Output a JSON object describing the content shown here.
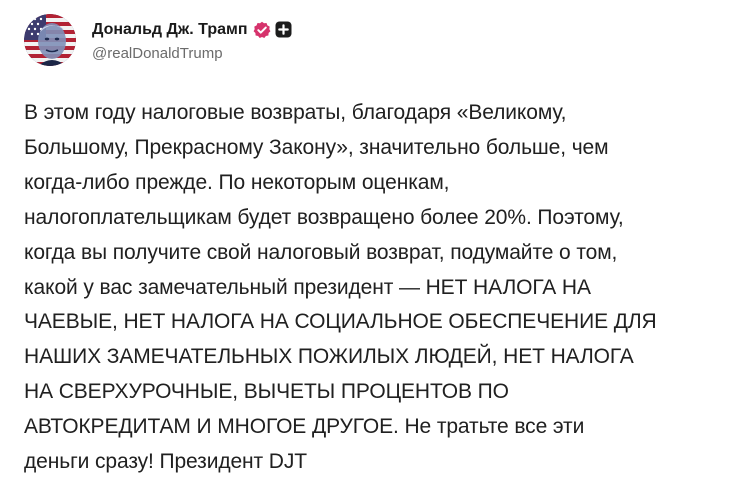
{
  "author": {
    "display_name": "Дональд Дж. Трамп",
    "handle": "@realDonaldTrump",
    "verified_color": "#d6336c",
    "icons": [
      "avatar",
      "verified-badge-icon",
      "add-icon"
    ]
  },
  "post": {
    "lines": [
      "В этом году налоговые возвраты, благодаря «Великому,",
      "Большому, Прекрасному Закону», значительно больше, чем",
      "когда-либо прежде. По некоторым оценкам,",
      "налогоплательщикам будет возвращено более 20%. Поэтому,",
      "когда вы получите свой налоговый возврат, подумайте о том,",
      "какой у вас замечательный президент — НЕТ НАЛОГА НА",
      "ЧАЕВЫЕ, НЕТ НАЛОГА НА СОЦИАЛЬНОЕ ОБЕСПЕЧЕНИЕ ДЛЯ",
      "НАШИХ ЗАМЕЧАТЕЛЬНЫХ ПОЖИЛЫХ ЛЮДЕЙ, НЕТ НАЛОГА",
      "НА СВЕРХУРОЧНЫЕ, ВЫЧЕТЫ ПРОЦЕНТОВ ПО",
      "АВТОКРЕДИТАМ И МНОГОЕ ДРУГОЕ. Не тратьте все эти",
      "деньги сразу! Президент DJT"
    ]
  }
}
